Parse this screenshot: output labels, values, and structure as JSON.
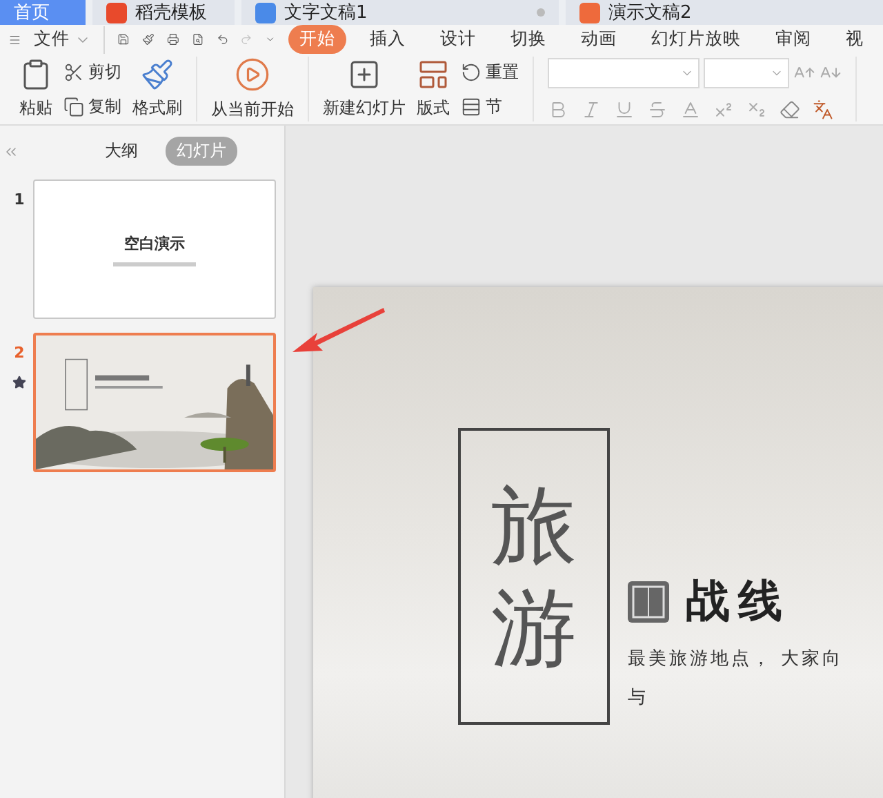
{
  "doc_tabs": [
    {
      "label": "首页",
      "kind": "home",
      "selected": true,
      "modified": false
    },
    {
      "label": "稻壳模板",
      "kind": "template",
      "selected": false,
      "modified": false
    },
    {
      "label": "文字文稿1",
      "kind": "writer",
      "selected": false,
      "modified": true
    },
    {
      "label": "演示文稿2",
      "kind": "presentation",
      "selected": false,
      "modified": false
    }
  ],
  "file_menu": {
    "label": "文件"
  },
  "ribbon_tabs": [
    {
      "label": "开始",
      "selected": true
    },
    {
      "label": "插入",
      "selected": false
    },
    {
      "label": "设计",
      "selected": false
    },
    {
      "label": "切换",
      "selected": false
    },
    {
      "label": "动画",
      "selected": false
    },
    {
      "label": "幻灯片放映",
      "selected": false
    },
    {
      "label": "审阅",
      "selected": false
    },
    {
      "label": "视",
      "selected": false
    }
  ],
  "ribbon": {
    "paste": "粘贴",
    "cut": "剪切",
    "copy": "复制",
    "format_painter": "格式刷",
    "play_from_current": "从当前开始",
    "new_slide": "新建幻灯片",
    "layout": "版式",
    "reset": "重置",
    "section": "节"
  },
  "panel_tabs": [
    {
      "label": "大纲",
      "selected": false
    },
    {
      "label": "幻灯片",
      "selected": true
    }
  ],
  "slides": [
    {
      "number": "1",
      "kind": "blank",
      "title": "空白演示",
      "selected": false,
      "animated": false
    },
    {
      "number": "2",
      "kind": "picture",
      "selected": true,
      "animated": true
    }
  ],
  "slide": {
    "vertical_title": [
      "旅",
      "游"
    ],
    "heading": "战线",
    "body": [
      "最美旅游地点， 大家向",
      "与"
    ]
  }
}
